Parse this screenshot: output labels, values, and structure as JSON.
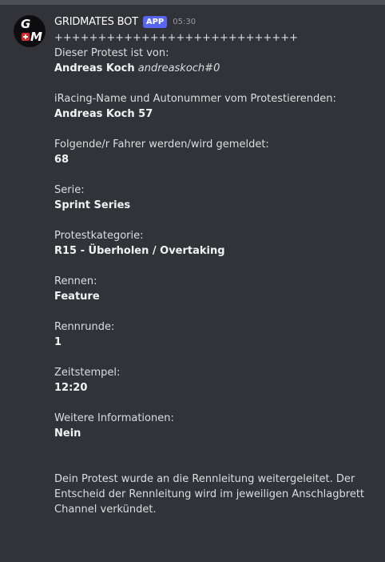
{
  "bot": {
    "name": "GRIDMATES BOT",
    "badge": "APP",
    "time": "05:30",
    "avatar_letter_top": "G",
    "avatar_letter_bottom": "M"
  },
  "message": {
    "separator": "++++++++++++++++++++++++++++",
    "protest_from_label": "Dieser Protest ist von:",
    "protester_name": "Andreas Koch",
    "protester_handle": "andreaskoch#0",
    "iracing_label": "iRacing-Name und Autonummer vom Protestierenden:",
    "iracing_value": "Andreas Koch 57",
    "drivers_label": "Folgende/r Fahrer werden/wird gemeldet:",
    "drivers_value": "68",
    "series_label": "Serie:",
    "series_value": "Sprint Series",
    "category_label": "Protestkategorie:",
    "category_value": "R15 - Überholen / Overtaking",
    "race_label": "Rennen:",
    "race_value": "Feature",
    "lap_label": "Rennrunde:",
    "lap_value": "1",
    "timestamp_label": "Zeitstempel:",
    "timestamp_value": "12:20",
    "info_label": "Weitere Informationen:",
    "info_value": "Nein",
    "footer": "Dein Protest wurde an die Rennleitung weitergeleitet. Der Entscheid der Rennleitung wird im jeweiligen Anschlagbrett Channel verkündet."
  },
  "colors": {
    "background": "#313338",
    "text": "#dbdee1",
    "badge": "#5865f2",
    "timestamp": "#949ba4"
  }
}
